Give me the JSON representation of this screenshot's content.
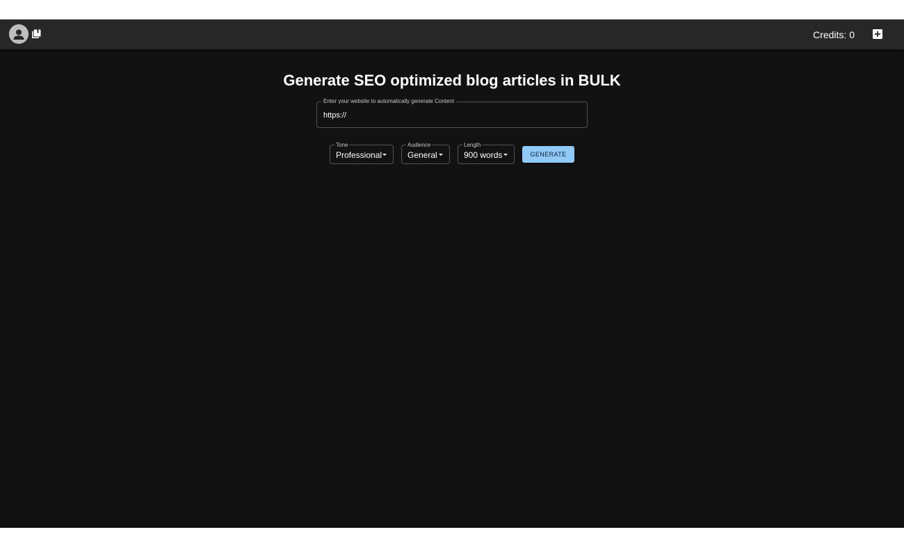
{
  "topbar": {
    "avatar_icon": "person-icon",
    "library_icon": "library-books-icon",
    "credits_text": "Credits: 0",
    "add_icon": "add-box-icon"
  },
  "main": {
    "title": "Generate SEO optimized blog articles in BULK",
    "url_field": {
      "label": "Enter your website to automatically generate Content",
      "value": "https://"
    },
    "selects": {
      "tone": {
        "label": "Tone",
        "value": "Professional"
      },
      "audience": {
        "label": "Audience",
        "value": "General"
      },
      "length": {
        "label": "Length",
        "value": "900 words"
      }
    },
    "generate_label": "GENERATE"
  },
  "colors": {
    "background": "#121212",
    "topbar": "#272727",
    "accent": "#90caf9"
  }
}
